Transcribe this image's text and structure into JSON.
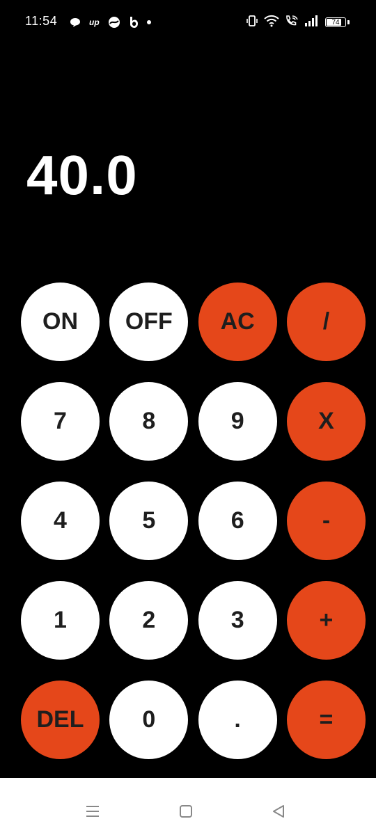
{
  "status_bar": {
    "time": "11:54",
    "up_label": "up",
    "battery": "74"
  },
  "display": {
    "value": "40.0"
  },
  "keys": [
    {
      "label": "ON",
      "style": "white"
    },
    {
      "label": "OFF",
      "style": "white"
    },
    {
      "label": "AC",
      "style": "orange"
    },
    {
      "label": "/",
      "style": "orange"
    },
    {
      "label": "7",
      "style": "white"
    },
    {
      "label": "8",
      "style": "white"
    },
    {
      "label": "9",
      "style": "white"
    },
    {
      "label": "X",
      "style": "orange"
    },
    {
      "label": "4",
      "style": "white"
    },
    {
      "label": "5",
      "style": "white"
    },
    {
      "label": "6",
      "style": "white"
    },
    {
      "label": "-",
      "style": "orange"
    },
    {
      "label": "1",
      "style": "white"
    },
    {
      "label": "2",
      "style": "white"
    },
    {
      "label": "3",
      "style": "white"
    },
    {
      "label": "+",
      "style": "orange"
    },
    {
      "label": "DEL",
      "style": "orange"
    },
    {
      "label": "0",
      "style": "white"
    },
    {
      "label": ".",
      "style": "white"
    },
    {
      "label": "=",
      "style": "orange"
    }
  ],
  "colors": {
    "background": "#000000",
    "accent": "#e5471a",
    "key_light": "#ffffff",
    "key_text": "#1e1e1e"
  },
  "icons": {
    "status_left": [
      "chat-bubble-icon",
      "up-app-icon",
      "circle-app-icon",
      "b-app-icon",
      "notification-dot-icon"
    ],
    "status_right": [
      "vibrate-icon",
      "wifi-icon",
      "wifi-call-icon",
      "signal-icon",
      "battery-icon"
    ],
    "nav": [
      "recents-icon",
      "home-icon",
      "back-icon"
    ]
  }
}
